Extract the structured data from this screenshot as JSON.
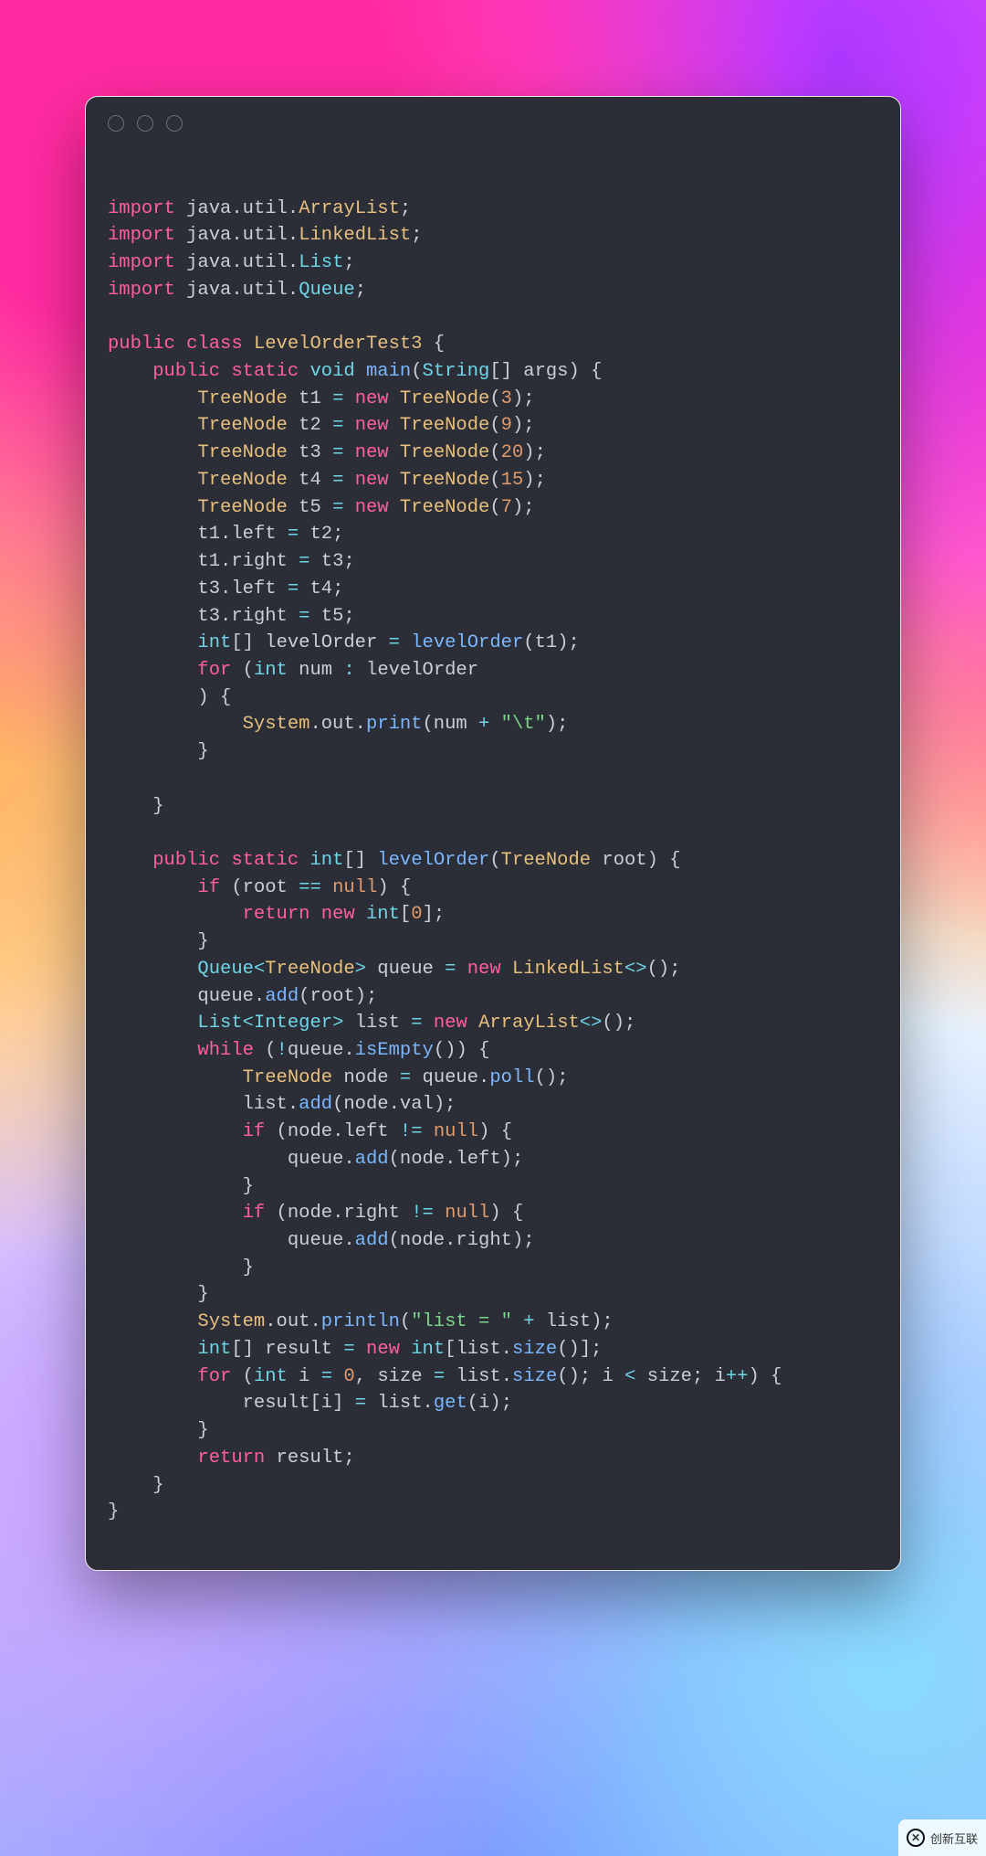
{
  "theme": {
    "window_bg": "#2b2d37",
    "text": "#c9cfd9",
    "keyword": "#ff5f9e",
    "type": "#6fd6e8",
    "class": "#e8c07d",
    "call": "#7bb7ff",
    "number": "#e29a6a",
    "string": "#7fd68a",
    "operator": "#6fd6e8",
    "null": "#e29a6a"
  },
  "titlebar": {
    "dots": 3
  },
  "code": {
    "language": "java",
    "imports": [
      "java.util.ArrayList",
      "java.util.LinkedList",
      "java.util.List",
      "java.util.Queue"
    ],
    "class_name": "LevelOrderTest3",
    "lines": [
      "",
      "import java.util.ArrayList;",
      "import java.util.LinkedList;",
      "import java.util.List;",
      "import java.util.Queue;",
      "",
      "public class LevelOrderTest3 {",
      "    public static void main(String[] args) {",
      "        TreeNode t1 = new TreeNode(3);",
      "        TreeNode t2 = new TreeNode(9);",
      "        TreeNode t3 = new TreeNode(20);",
      "        TreeNode t4 = new TreeNode(15);",
      "        TreeNode t5 = new TreeNode(7);",
      "        t1.left = t2;",
      "        t1.right = t3;",
      "        t3.left = t4;",
      "        t3.right = t5;",
      "        int[] levelOrder = levelOrder(t1);",
      "        for (int num : levelOrder",
      "        ) {",
      "            System.out.print(num + \"\\t\");",
      "        }",
      "",
      "    }",
      "",
      "    public static int[] levelOrder(TreeNode root) {",
      "        if (root == null) {",
      "            return new int[0];",
      "        }",
      "        Queue<TreeNode> queue = new LinkedList<>();",
      "        queue.add(root);",
      "        List<Integer> list = new ArrayList<>();",
      "        while (!queue.isEmpty()) {",
      "            TreeNode node = queue.poll();",
      "            list.add(node.val);",
      "            if (node.left != null) {",
      "                queue.add(node.left);",
      "            }",
      "            if (node.right != null) {",
      "                queue.add(node.right);",
      "            }",
      "        }",
      "        System.out.println(\"list = \" + list);",
      "        int[] result = new int[list.size()];",
      "        for (int i = 0, size = list.size(); i < size; i++) {",
      "            result[i] = list.get(i);",
      "        }",
      "        return result;",
      "    }",
      "}"
    ]
  },
  "watermark": {
    "text": "创新互联",
    "subtext": ""
  }
}
